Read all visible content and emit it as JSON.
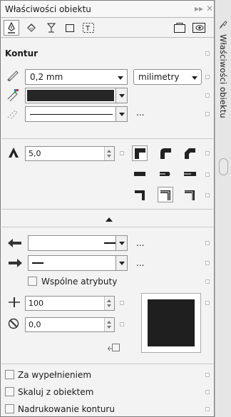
{
  "docker": {
    "title": "Właściwości obiektu",
    "pin_icon": "pin-icon",
    "close_icon": "close-icon",
    "side_tab_label": "Właściwości obiektu"
  },
  "tabs": [
    {
      "icon": "outline-pen-icon",
      "active": true
    },
    {
      "icon": "fill-bucket-icon",
      "active": false
    },
    {
      "icon": "transparency-icon",
      "active": false
    },
    {
      "icon": "frame-icon",
      "active": false
    },
    {
      "icon": "text-frame-icon",
      "active": false
    },
    {
      "icon": "summary-icon",
      "active": false
    },
    {
      "icon": "preview-eye-icon",
      "active": false
    }
  ],
  "outline": {
    "section_title": "Kontur",
    "width_value": "0,2 mm",
    "units_value": "milimetry",
    "color": "#262626",
    "style_more": "...",
    "miter_limit": "5,0",
    "start_more": "...",
    "end_more": "...",
    "shared_attributes_label": "Wspólne atrybuty",
    "stretch_value": "100",
    "angle_value": "0,0",
    "behind_fill_label": "Za wypełnieniem",
    "scale_with_object_label": "Skaluj z obiektem",
    "overprint_label": "Nadrukowanie konturu"
  }
}
